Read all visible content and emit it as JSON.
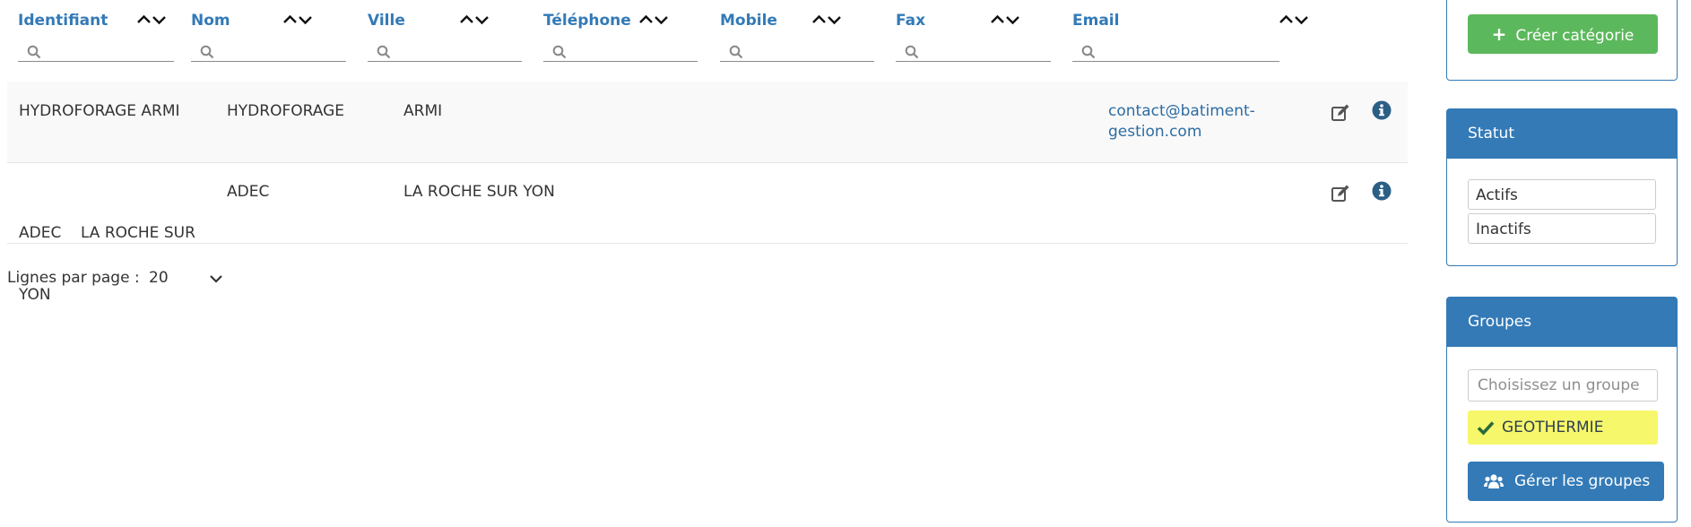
{
  "table": {
    "columns": [
      {
        "label": "Identifiant",
        "filter_value": ""
      },
      {
        "label": "Nom",
        "filter_value": ""
      },
      {
        "label": "Ville",
        "filter_value": ""
      },
      {
        "label": "Téléphone",
        "filter_value": ""
      },
      {
        "label": "Mobile",
        "filter_value": ""
      },
      {
        "label": "Fax",
        "filter_value": ""
      },
      {
        "label": "Email",
        "filter_value": ""
      }
    ],
    "rows": [
      {
        "identifiant_1": "HYDROFORAGE ARMI",
        "identifiant_2": "",
        "nom": "HYDROFORAGE",
        "ville": "ARMI",
        "telephone": "",
        "mobile": "",
        "fax": "",
        "email_1": "contact@batiment-",
        "email_2": "gestion.com"
      },
      {
        "identifiant_1": "ADEC    LA ROCHE SUR",
        "identifiant_2": "YON",
        "nom": "ADEC",
        "ville": "LA ROCHE SUR YON",
        "telephone": "",
        "mobile": "",
        "fax": "",
        "email_1": "",
        "email_2": ""
      }
    ]
  },
  "pager": {
    "label": "Lignes par page :",
    "value": "20"
  },
  "sidebar": {
    "create_button": "Créer catégorie",
    "statut": {
      "title": "Statut",
      "options": [
        "Actifs",
        "Inactifs"
      ]
    },
    "groupes": {
      "title": "Groupes",
      "placeholder": "Choisissez un groupe",
      "selected_tag": "GEOTHERMIE",
      "manage_button": "Gérer les groupes"
    }
  },
  "colors": {
    "link": "#337ab7",
    "success": "#5cb85c",
    "primary": "#337ab7",
    "tag_bg": "#f7f76b"
  },
  "icons": [
    "search-icon",
    "sort-up-icon",
    "sort-down-icon",
    "edit-icon",
    "info-icon",
    "chevron-down-icon",
    "plus-icon",
    "check-icon",
    "users-icon"
  ]
}
